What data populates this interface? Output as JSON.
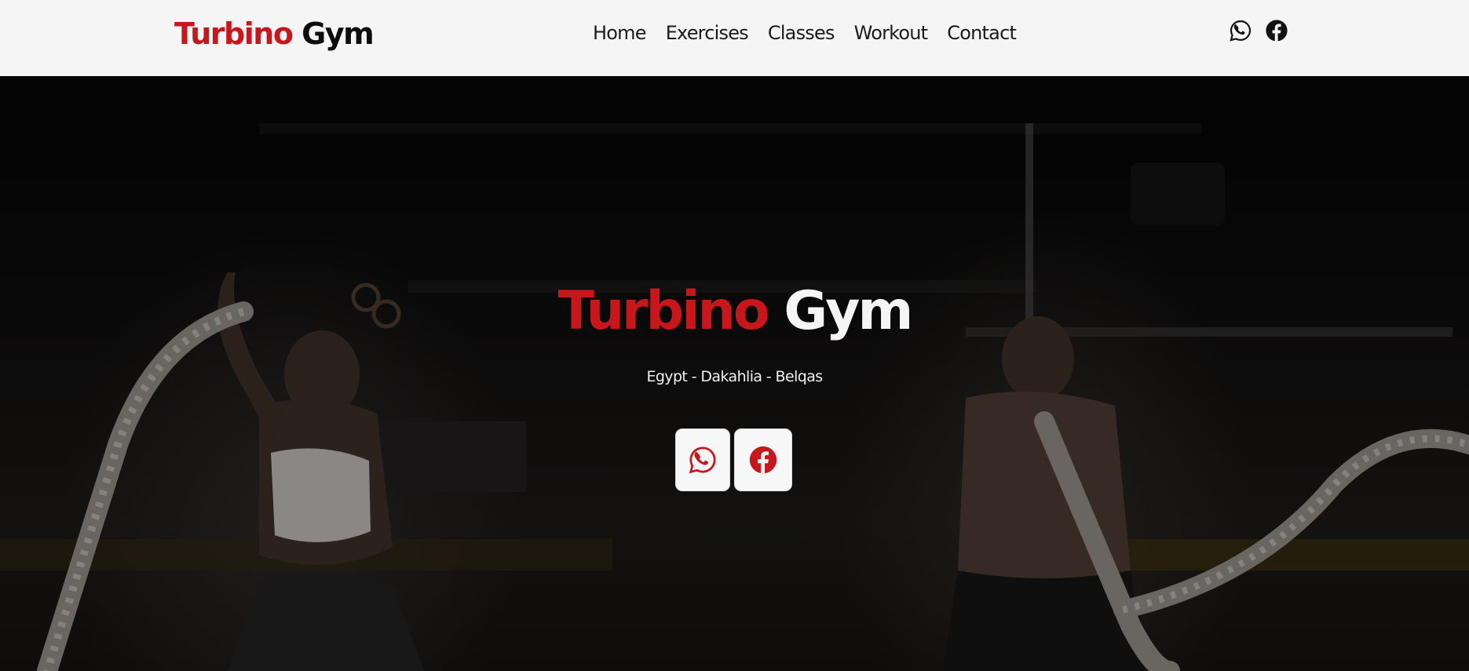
{
  "navbar": {
    "brand_first": "Turbino",
    "brand_second": "Gym",
    "links": [
      "Home",
      "Exercises",
      "Classes",
      "Workout",
      "Contact"
    ],
    "icons": [
      "whatsapp-icon",
      "facebook-icon"
    ]
  },
  "hero": {
    "title_first": "Turbino",
    "title_second": "Gym",
    "subtitle": "Egypt - Dakahlia - Belqas",
    "buttons": [
      "whatsapp-icon",
      "facebook-icon"
    ]
  },
  "colors": {
    "accent": "#c8161d",
    "navbar_bg": "#f5f5f5",
    "hero_bg": "#0a0a0a"
  }
}
